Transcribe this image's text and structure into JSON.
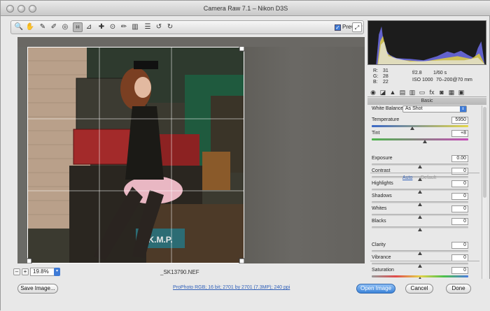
{
  "window": {
    "title": "Camera Raw 7.1  –  Nikon D3S"
  },
  "toolbar": {
    "tools": [
      {
        "icon": "zoom-icon",
        "glyph": "🔍"
      },
      {
        "icon": "hand-icon",
        "glyph": "✋"
      },
      {
        "icon": "white-balance-icon",
        "glyph": "✎"
      },
      {
        "icon": "color-sampler-icon",
        "glyph": "✐"
      },
      {
        "icon": "targeted-adjustment-icon",
        "glyph": "◎"
      },
      {
        "icon": "crop-icon",
        "glyph": "⌗"
      },
      {
        "icon": "straighten-icon",
        "glyph": "⊿"
      },
      {
        "icon": "spot-removal-icon",
        "glyph": "✚"
      },
      {
        "icon": "red-eye-icon",
        "glyph": "⊙"
      },
      {
        "icon": "adjustment-brush-icon",
        "glyph": "✏"
      },
      {
        "icon": "graduated-filter-icon",
        "glyph": "▥"
      },
      {
        "icon": "preferences-icon",
        "glyph": "☰"
      },
      {
        "icon": "rotate-left-icon",
        "glyph": "↺"
      },
      {
        "icon": "rotate-right-icon",
        "glyph": "↻"
      }
    ],
    "preview_label": "Preview",
    "preview_checked": true
  },
  "status": {
    "zoom": "19.8%",
    "filename": "_SK13790.NEF"
  },
  "readout": {
    "r_label": "R:",
    "r": "31",
    "g_label": "G:",
    "g": "28",
    "b_label": "B:",
    "b": "22",
    "aperture": "f/2.8",
    "shutter": "1/60 s",
    "iso": "ISO 1000",
    "lens": "70–200@70 mm"
  },
  "panel": {
    "title": "Basic",
    "wb_label": "White Balance:",
    "wb_value": "As Shot",
    "auto": "Auto",
    "default": "Default",
    "sliders": [
      {
        "label": "Temperature",
        "value": "5950",
        "pos": 0.42,
        "style": "temp"
      },
      {
        "label": "Tint",
        "value": "+8",
        "pos": 0.55,
        "style": "tint"
      },
      {
        "label": "Exposure",
        "value": "0.00",
        "pos": 0.5,
        "style": ""
      },
      {
        "label": "Contrast",
        "value": "0",
        "pos": 0.5,
        "style": ""
      },
      {
        "label": "Highlights",
        "value": "0",
        "pos": 0.5,
        "style": ""
      },
      {
        "label": "Shadows",
        "value": "0",
        "pos": 0.5,
        "style": ""
      },
      {
        "label": "Whites",
        "value": "0",
        "pos": 0.5,
        "style": ""
      },
      {
        "label": "Blacks",
        "value": "0",
        "pos": 0.5,
        "style": ""
      },
      {
        "label": "Clarity",
        "value": "0",
        "pos": 0.5,
        "style": ""
      },
      {
        "label": "Vibrance",
        "value": "0",
        "pos": 0.5,
        "style": ""
      },
      {
        "label": "Saturation",
        "value": "0",
        "pos": 0.5,
        "style": "sat"
      }
    ]
  },
  "photo": {
    "sign_text": "K.M.P."
  },
  "footer": {
    "save": "Save Image...",
    "workflow": "ProPhoto RGB; 16 bit; 2701 by 2701 (7.3MP); 240 ppi",
    "open": "Open Image",
    "cancel": "Cancel",
    "done": "Done"
  }
}
